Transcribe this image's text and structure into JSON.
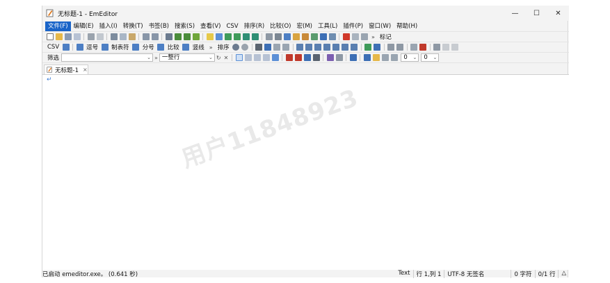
{
  "window": {
    "title": "无标题-1 - EmEditor",
    "controls": {
      "minimize": "—",
      "maximize": "☐",
      "close": "✕"
    }
  },
  "menu": [
    "文件(F)",
    "编辑(E)",
    "插入(I)",
    "转换(T)",
    "书签(B)",
    "搜索(S)",
    "查看(V)",
    "CSV",
    "排序(R)",
    "比较(O)",
    "宏(M)",
    "工具(L)",
    "插件(P)",
    "窗口(W)",
    "帮助(H)"
  ],
  "toolbar1": {
    "more": "»",
    "marker_label": "标记"
  },
  "toolbar2": {
    "csv_label": "CSV",
    "buttons": [
      "逗号",
      "制表符",
      "分号",
      "比较",
      "竖线"
    ],
    "more": "»",
    "sort_label": "排序"
  },
  "toolbar3": {
    "filter_label": "筛选",
    "filter_value": "",
    "scope_value": "一整行",
    "combo1_value": "0",
    "combo2_value": "0"
  },
  "tabs": [
    {
      "label": "无标题-1",
      "close": "×"
    }
  ],
  "editor": {
    "eol_mark": "↵",
    "watermark": "用户11848923"
  },
  "status": {
    "message": "已启动 emeditor.exe。 (0.641 秒)",
    "mode": "Text",
    "position": "行 1,列 1",
    "encoding": "UTF-8 无签名",
    "chars": "0 字符",
    "lines": "0/1 行"
  },
  "colors": {
    "accent": "#1a64c8",
    "chrome_bg": "#f3f3f3",
    "editor_bg": "#ffffff"
  }
}
